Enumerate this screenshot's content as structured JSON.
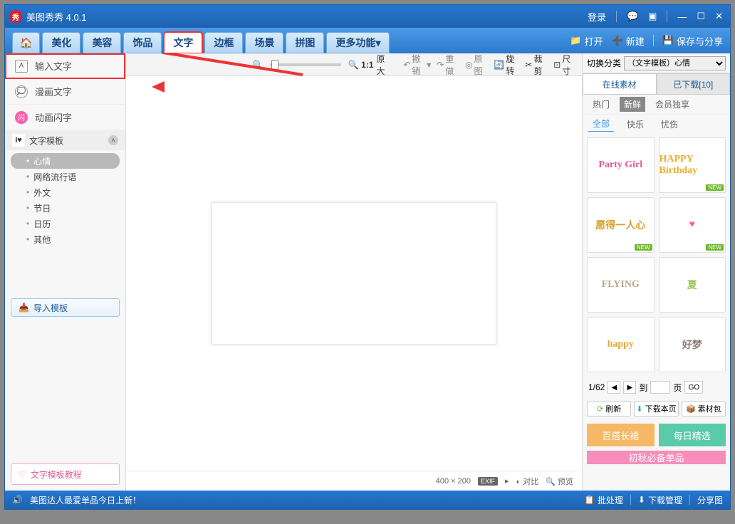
{
  "titlebar": {
    "app": "美图秀秀 4.0.1",
    "login": "登录"
  },
  "tabs": {
    "beautify": "美化",
    "face": "美容",
    "accessory": "饰品",
    "text": "文字",
    "border": "边框",
    "scene": "场景",
    "puzzle": "拼图",
    "more": "更多功能"
  },
  "toolbar_right": {
    "open": "打开",
    "new": "新建",
    "save_share": "保存与分享"
  },
  "subbar": {
    "ratio": "1:1",
    "orig_size": "原大",
    "undo": "撤销",
    "redo": "重做",
    "original": "原图",
    "rotate": "旋转",
    "crop": "裁剪",
    "size": "尺寸"
  },
  "left": {
    "input_text": "输入文字",
    "comic_text": "漫画文字",
    "anim_text": "动画闪字",
    "template_header": "文字模板",
    "tree": {
      "mood": "心情",
      "net": "网络流行语",
      "foreign": "外文",
      "festival": "节日",
      "calendar": "日历",
      "other": "其他"
    },
    "import": "导入模板",
    "tutorial": "文字模板教程"
  },
  "canvas": {
    "dims": "400 × 200",
    "exif": "EXIF",
    "compare": "对比",
    "preview": "预览"
  },
  "right": {
    "switch_label": "切换分类",
    "switch_value": "（文字模板）心情",
    "tabs": {
      "online": "在线素材",
      "downloaded": "已下载[10]"
    },
    "filters": {
      "hot": "热门",
      "new": "新鲜",
      "member": "会员独享"
    },
    "cats": {
      "all": "全部",
      "happy": "快乐",
      "sad": "忧伤"
    },
    "new_badge": "NEW",
    "thumbs": [
      {
        "text": "Party Girl",
        "color": "#e05a9a",
        "badge": false
      },
      {
        "text": "HAPPY Birthday",
        "color": "#e8b030",
        "badge": true
      },
      {
        "text": "愿得一人心",
        "color": "#d8a030",
        "badge": true
      },
      {
        "text": "♥",
        "color": "#ff5ba8",
        "badge": true
      },
      {
        "text": "FLYING",
        "color": "#b8a888",
        "badge": false
      },
      {
        "text": "夏",
        "color": "#9fc860",
        "badge": false
      },
      {
        "text": "happy",
        "color": "#e8a830",
        "badge": false
      },
      {
        "text": "好梦",
        "color": "#8a7a78",
        "badge": false
      }
    ],
    "pager": {
      "pos": "1/62",
      "goto": "到",
      "page": "页",
      "go": "GO"
    },
    "actions": {
      "refresh": "刷新",
      "download_page": "下载本页",
      "pack": "素材包"
    },
    "promos": {
      "skirt": "百搭长裙",
      "daily": "每日精选",
      "autumn": "初秋必备单品"
    }
  },
  "status": {
    "news": "美图达人最爱单品今日上新！",
    "batch": "批处理",
    "dl_mgr": "下载管理",
    "share": "分享图"
  }
}
